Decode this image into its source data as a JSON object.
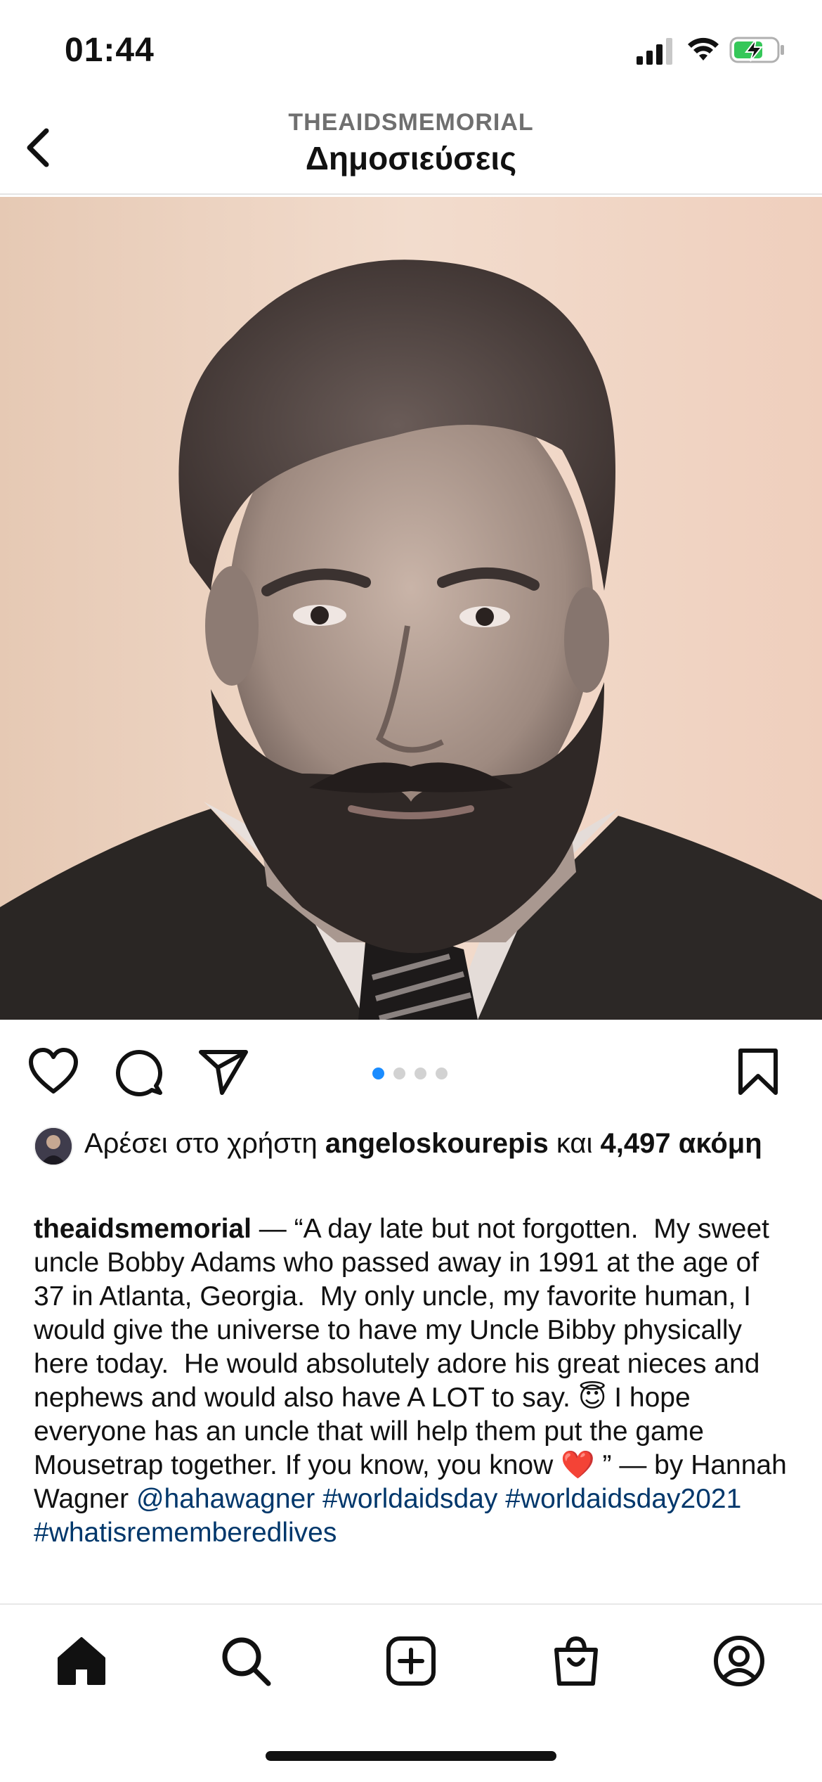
{
  "status_bar": {
    "time": "01:44"
  },
  "header": {
    "account": "THEAIDSMEMORIAL",
    "title": "Δημοσιεύσεις"
  },
  "post": {
    "image_description_icon": "portrait-photo",
    "carousel": {
      "count": 4,
      "active_index": 0
    },
    "likes": {
      "prefix": "Αρέσει στο χρήστη ",
      "user": "angeloskourepis",
      "middle": " και ",
      "count": "4,497",
      "suffix": "ακόμη"
    },
    "caption": {
      "username": "theaidsmemorial",
      "text_part1": " — “A day late but not forgotten.  My sweet uncle Bobby Adams who passed away in 1991 at the age of 37 in Atlanta, Georgia.  My only uncle, my favorite human, I would give the universe to have my Uncle Bibby physically here today.  He would absolutely adore his great nieces and nephews and would also have A LOT to say. ",
      "emoji1": "😇",
      "text_part2": " I hope everyone has an uncle that will help them put the game Mousetrap together. If you know, you know ",
      "emoji2": "❤️",
      "text_part3": " ” — by Hannah Wagner ",
      "tags": [
        "@hahawagner",
        "#worldaidsday",
        "#worldaidsday2021",
        "#whatisrememberedlives"
      ]
    }
  },
  "colors": {
    "accent": "#1a8cff",
    "link": "#00376b",
    "battery_green": "#35c759"
  }
}
